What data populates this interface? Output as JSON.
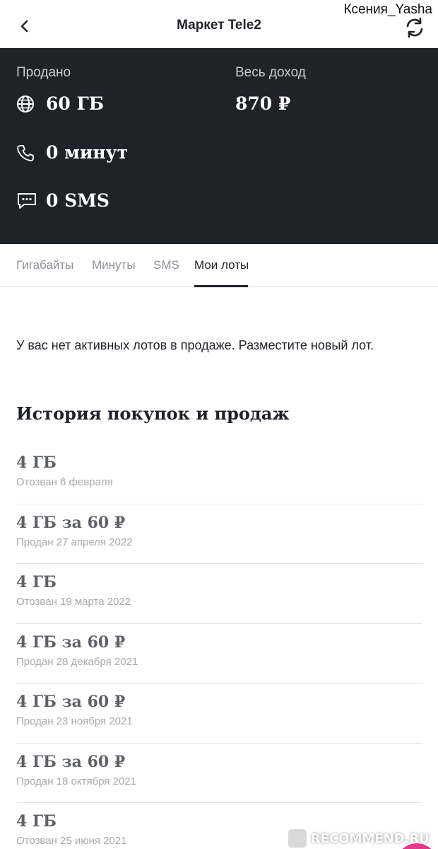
{
  "header": {
    "title": "Маркет Tele2",
    "watermark_user": "Ксения_Yasha",
    "back_icon": "chevron-left-icon",
    "refresh_icon": "refresh-icon"
  },
  "stats": {
    "sold_label": "Продано",
    "income_label": "Весь доход",
    "data_value": "60 ГБ",
    "income_value": "870 ₽",
    "minutes_value": "0 минут",
    "sms_value": "0 SMS"
  },
  "tabs": [
    {
      "label": "Гигабайты",
      "active": false
    },
    {
      "label": "Минуты",
      "active": false
    },
    {
      "label": "SMS",
      "active": false
    },
    {
      "label": "Мои лоты",
      "active": true
    }
  ],
  "empty_message": "У вас нет активных лотов в продаже. Разместите новый лот.",
  "history": {
    "title": "История покупок и продаж",
    "items": [
      {
        "amount": "4 ГБ",
        "status": "Отозван 6 февраля"
      },
      {
        "amount": "4 ГБ за 60 ₽",
        "status": "Продан 27 апреля 2022"
      },
      {
        "amount": "4 ГБ",
        "status": "Отозван 19 марта 2022"
      },
      {
        "amount": "4 ГБ за 60 ₽",
        "status": "Продан 28 декабря 2021"
      },
      {
        "amount": "4 ГБ за 60 ₽",
        "status": "Продан 23 ноября 2021"
      },
      {
        "amount": "4 ГБ за 60 ₽",
        "status": "Продан 18 октября 2021"
      },
      {
        "amount": "4 ГБ",
        "status": "Отозван 25 июня 2021"
      }
    ]
  },
  "watermark": "RECOMMEND.RU",
  "colors": {
    "dark_panel": "#1f2229",
    "accent_pink": "#e23a8a"
  }
}
